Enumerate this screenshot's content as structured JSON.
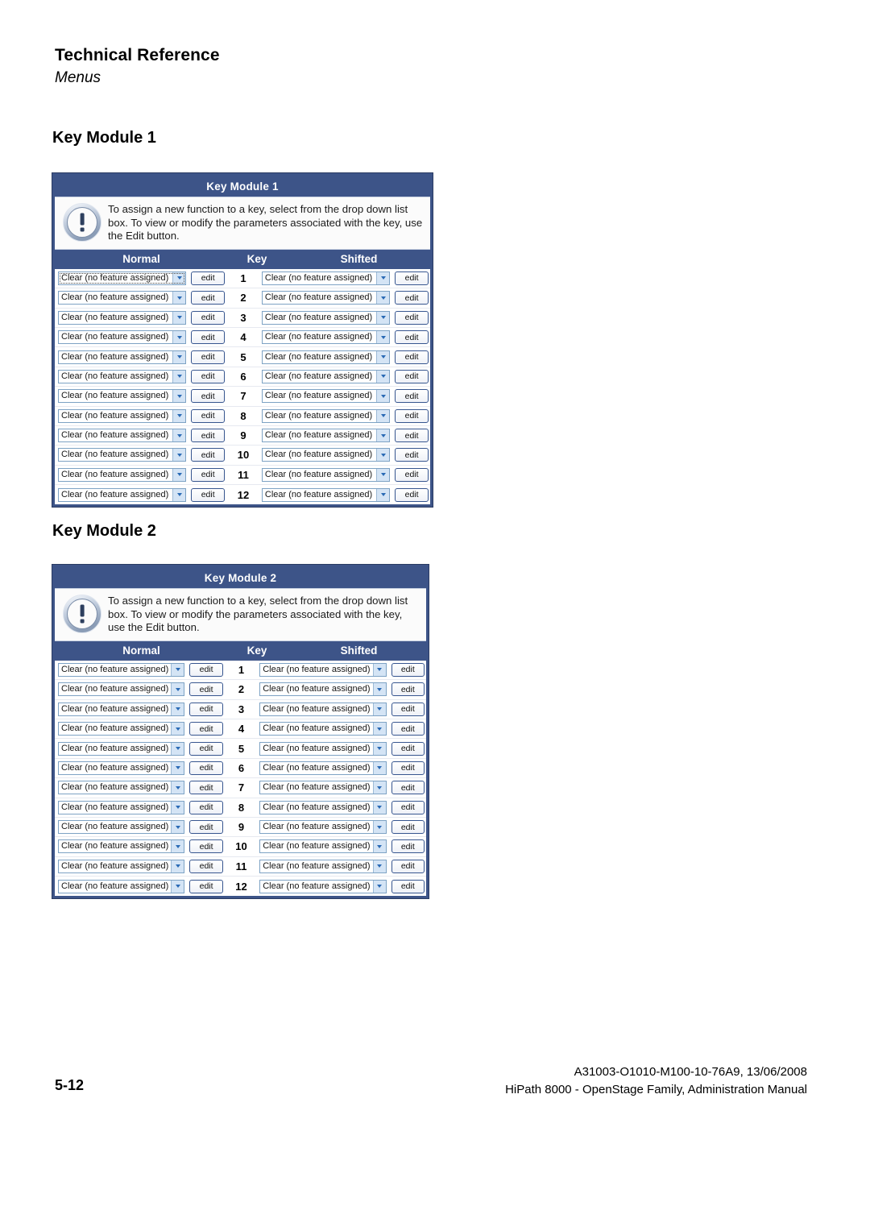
{
  "header": {
    "title": "Technical Reference",
    "subtitle": "Menus"
  },
  "sections": [
    {
      "heading": "Key Module 1",
      "panel": {
        "titlebar": "Key Module 1",
        "info_icon": "exclamation-circle-icon",
        "info_text": "To assign a new function to a key, select from the drop down list box. To view or modify the parameters associated with the key, use the Edit button.",
        "columns": {
          "normal": "Normal",
          "key": "Key",
          "shifted": "Shifted"
        },
        "select_value": "Clear (no feature assigned)",
        "edit_label": "edit",
        "rows": [
          "1",
          "2",
          "3",
          "4",
          "5",
          "6",
          "7",
          "8",
          "9",
          "10",
          "11",
          "12"
        ],
        "focused_row_index": 0
      }
    },
    {
      "heading": "Key Module 2",
      "panel": {
        "titlebar": "Key Module 2",
        "info_icon": "exclamation-circle-icon",
        "info_text": "To assign a new function to a key, select from the drop down list box. To view or modify the parameters associated with the key, use the Edit button.",
        "columns": {
          "normal": "Normal",
          "key": "Key",
          "shifted": "Shifted"
        },
        "select_value": "Clear (no feature assigned)",
        "edit_label": "edit",
        "rows": [
          "1",
          "2",
          "3",
          "4",
          "5",
          "6",
          "7",
          "8",
          "9",
          "10",
          "11",
          "12"
        ],
        "focused_row_index": -1
      }
    }
  ],
  "footer": {
    "page_number": "5-12",
    "doc_id": "A31003-O1010-M100-10-76A9, 13/06/2008",
    "product_line": "HiPath 8000 - OpenStage Family, Administration Manual"
  },
  "colors": {
    "panel_blue": "#3d5488",
    "panel_border": "#2b3c63",
    "select_border": "#7da2c4",
    "button_border": "#36558f",
    "arrow_fill": "#2a6ab5"
  }
}
